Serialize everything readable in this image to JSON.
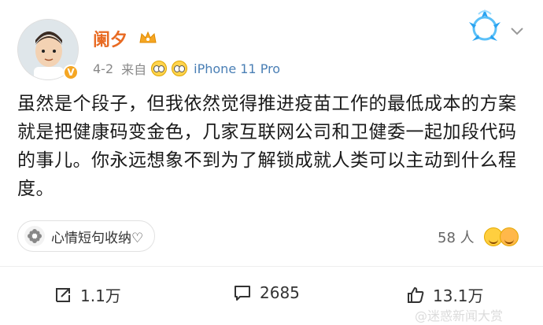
{
  "post": {
    "author": {
      "name": "阑夕",
      "verified": true
    },
    "meta": {
      "date": "4-2",
      "source_prefix": "来自",
      "device": "iPhone 11 Pro"
    },
    "text": "虽然是个段子，但我依然觉得推进疫苗工作的最低成本的方案就是把健康码变金色，几家互联网公司和卫健委一起加段代码的事儿。你永远想象不到为了解锁成就人类可以主动到什么程度。",
    "tag": {
      "label": "心情短句收纳♡"
    },
    "reactions": {
      "count_label": "58 人"
    },
    "actions": {
      "repost": "1.1万",
      "comment": "2685",
      "like": "13.1万"
    }
  },
  "watermark": {
    "text": "@迷惑新闻大赏"
  },
  "colors": {
    "author_name": "#e86a22",
    "device_link": "#4a7fb5",
    "text": "#1a1a1a"
  }
}
